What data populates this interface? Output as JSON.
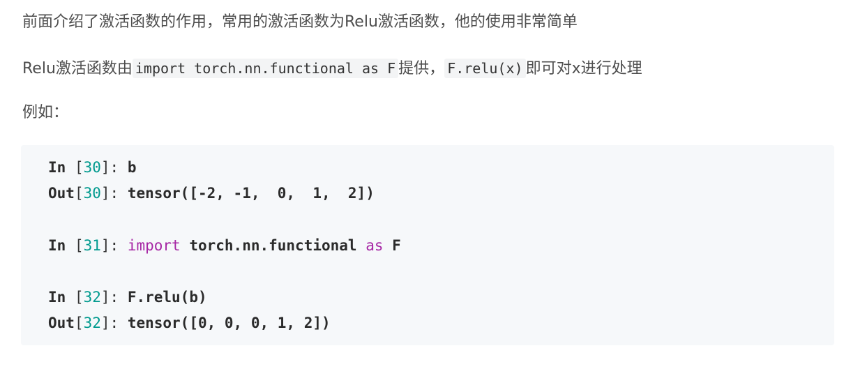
{
  "paragraphs": {
    "p1": "前面介绍了激活函数的作用，常用的激活函数为Relu激活函数，他的使用非常简单",
    "p2_pre": "Relu激活函数由",
    "p2_code1": "import torch.nn.functional as F",
    "p2_mid": "提供，",
    "p2_code2": "F.relu(x)",
    "p2_post": "即可对x进行处理",
    "p3": "例如："
  },
  "code": {
    "l1": {
      "prompt": "In",
      "open": " [",
      "num": "30",
      "close": "]: ",
      "rest": "b"
    },
    "l2": {
      "prompt": "Out",
      "open": "[",
      "num": "30",
      "close": "]: ",
      "rest": "tensor([-2, -1,  0,  1,  2])"
    },
    "l3": {
      "prompt": "In",
      "open": " [",
      "num": "31",
      "close": "]: ",
      "kw1": "import",
      "mid": " torch.nn.functional ",
      "kw2": "as",
      "end": " F"
    },
    "l4": {
      "prompt": "In",
      "open": " [",
      "num": "32",
      "close": "]: ",
      "rest": "F.relu(b)"
    },
    "l5": {
      "prompt": "Out",
      "open": "[",
      "num": "32",
      "close": "]: ",
      "rest": "tensor([0, 0, 0, 1, 2])"
    }
  },
  "colors": {
    "text": "#4d4d4d",
    "code_bg": "#f6f8fa",
    "number": "#009a8e",
    "keyword": "#a626a4"
  }
}
